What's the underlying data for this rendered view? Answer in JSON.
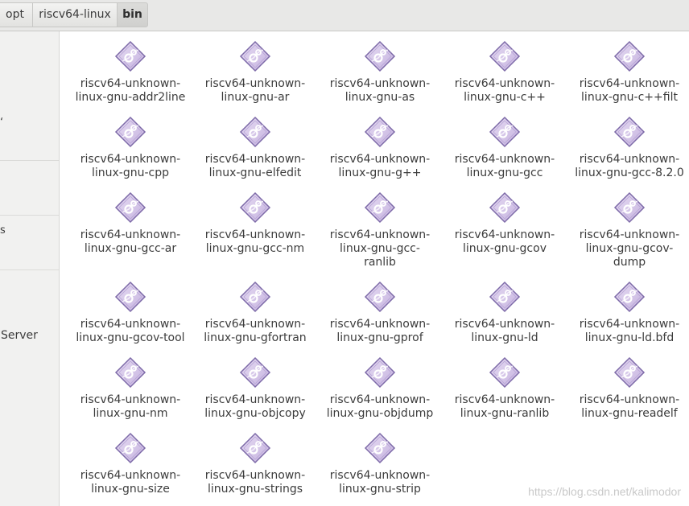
{
  "breadcrumb": [
    "opt",
    "riscv64-linux",
    "bin"
  ],
  "sidebar": {
    "server_label": "Server",
    "fragment_1": "s",
    "fragment_2": "s"
  },
  "files": [
    {
      "line1": "riscv64-unknown-",
      "line2": "linux-gnu-addr2line"
    },
    {
      "line1": "riscv64-unknown-",
      "line2": "linux-gnu-ar"
    },
    {
      "line1": "riscv64-unknown-",
      "line2": "linux-gnu-as"
    },
    {
      "line1": "riscv64-unknown-",
      "line2": "linux-gnu-c++"
    },
    {
      "line1": "riscv64-unknown-",
      "line2": "linux-gnu-c++filt"
    },
    {
      "line1": "riscv64-unknown-",
      "line2": "linux-gnu-cpp"
    },
    {
      "line1": "riscv64-unknown-",
      "line2": "linux-gnu-elfedit"
    },
    {
      "line1": "riscv64-unknown-",
      "line2": "linux-gnu-g++"
    },
    {
      "line1": "riscv64-unknown-",
      "line2": "linux-gnu-gcc"
    },
    {
      "line1": "riscv64-unknown-",
      "line2": "linux-gnu-gcc-8.2.0"
    },
    {
      "line1": "riscv64-unknown-",
      "line2": "linux-gnu-gcc-ar"
    },
    {
      "line1": "riscv64-unknown-",
      "line2": "linux-gnu-gcc-nm"
    },
    {
      "line1": "riscv64-unknown-",
      "line2": "linux-gnu-gcc-",
      "line3": "ranlib"
    },
    {
      "line1": "riscv64-unknown-",
      "line2": "linux-gnu-gcov"
    },
    {
      "line1": "riscv64-unknown-",
      "line2": "linux-gnu-gcov-",
      "line3": "dump"
    },
    {
      "line1": "riscv64-unknown-",
      "line2": "linux-gnu-gcov-tool"
    },
    {
      "line1": "riscv64-unknown-",
      "line2": "linux-gnu-gfortran"
    },
    {
      "line1": "riscv64-unknown-",
      "line2": "linux-gnu-gprof"
    },
    {
      "line1": "riscv64-unknown-",
      "line2": "linux-gnu-ld"
    },
    {
      "line1": "riscv64-unknown-",
      "line2": "linux-gnu-ld.bfd"
    },
    {
      "line1": "riscv64-unknown-",
      "line2": "linux-gnu-nm"
    },
    {
      "line1": "riscv64-unknown-",
      "line2": "linux-gnu-objcopy"
    },
    {
      "line1": "riscv64-unknown-",
      "line2": "linux-gnu-objdump"
    },
    {
      "line1": "riscv64-unknown-",
      "line2": "linux-gnu-ranlib"
    },
    {
      "line1": "riscv64-unknown-",
      "line2": "linux-gnu-readelf"
    },
    {
      "line1": "riscv64-unknown-",
      "line2": "linux-gnu-size"
    },
    {
      "line1": "riscv64-unknown-",
      "line2": "linux-gnu-strings"
    },
    {
      "line1": "riscv64-unknown-",
      "line2": "linux-gnu-strip"
    }
  ],
  "file_icon": "executable-icon",
  "icon_colors": {
    "fill": "#c6b3e0",
    "stroke": "#7d6aa8",
    "gear": "#ffffff"
  },
  "watermark": "https://blog.csdn.net/kalimodor"
}
